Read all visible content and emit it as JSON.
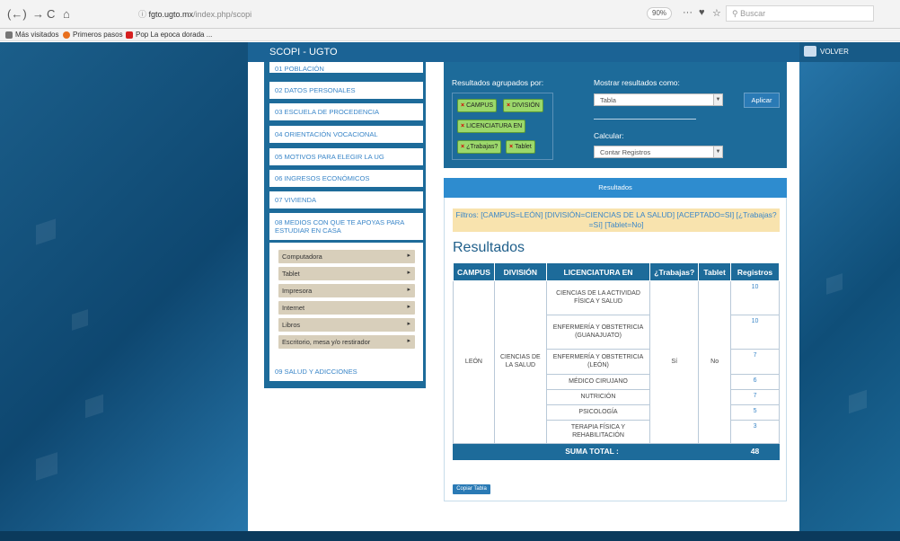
{
  "browser": {
    "url_info": "ⓘ",
    "url_host": "fgto.ugto.mx",
    "url_path": "/index.php/scopi",
    "zoom": "90%",
    "search_placeholder": "Buscar",
    "bookmarks": [
      {
        "label": "Más visitados",
        "color": "#777777"
      },
      {
        "label": "Primeros pasos",
        "color": "#e8701e"
      },
      {
        "label": "Pop La epoca dorada ...",
        "color": "#d62020"
      }
    ]
  },
  "header": {
    "title": "SCOPI - UGTO",
    "volver": "VOLVER"
  },
  "sidebar": {
    "items": [
      {
        "label": "01 POBLACIÓN"
      },
      {
        "label": "02 DATOS PERSONALES"
      },
      {
        "label": "03 ESCUELA DE PROCEDENCIA"
      },
      {
        "label": "04 ORIENTACIÓN VOCACIONAL"
      },
      {
        "label": "05 MOTIVOS PARA ELEGIR LA UG"
      },
      {
        "label": "06 INGRESOS ECONÓMICOS"
      },
      {
        "label": "07 VIVIENDA"
      },
      {
        "label": "08 MEDIOS CON QUE TE APOYAS PARA ESTUDIAR EN CASA"
      },
      {
        "label": "09 SALUD Y ADICCIONES"
      }
    ],
    "subitems": [
      "Computadora",
      "Tablet",
      "Impresora",
      "Internet",
      "Libros",
      "Escritorio, mesa y/o restirador"
    ]
  },
  "controls": {
    "group_label": "Resultados agrupados por:",
    "chips": [
      "CAMPUS",
      "DIVISIÓN",
      "LICENCIATURA EN",
      "¿Trabajas?",
      "Tablet"
    ],
    "show_label": "Mostrar resultados como:",
    "show_value": "Tabla",
    "apply": "Aplicar",
    "calc_label": "Calcular:",
    "calc_value": "Contar Registros"
  },
  "results": {
    "header": "Resultados",
    "filters": "Filtros: [CAMPUS=LEÓN] [DIVISIÓN=CIENCIAS DE LA SALUD] [ACEPTADO=SI] [¿Trabajas?=Sí] [Tablet=No]",
    "title": "Resultados",
    "columns": [
      "CAMPUS",
      "DIVISIÓN",
      "LICENCIATURA EN",
      "¿Trabajas?",
      "Tablet",
      "Registros"
    ],
    "campus": "LEÓN",
    "division": "CIENCIAS DE LA SALUD",
    "trabajas": "Sí",
    "tablet": "No",
    "rows": [
      {
        "licenciatura": "CIENCIAS DE LA ACTIVIDAD FÍSICA Y SALUD",
        "registros": "10"
      },
      {
        "licenciatura": "ENFERMERÍA Y OBSTETRICIA (GUANAJUATO)",
        "registros": "10"
      },
      {
        "licenciatura": "ENFERMERÍA Y OBSTETRICIA (LEÓN)",
        "registros": "7"
      },
      {
        "licenciatura": "MÉDICO CIRUJANO",
        "registros": "6"
      },
      {
        "licenciatura": "NUTRICIÓN",
        "registros": "7"
      },
      {
        "licenciatura": "PSICOLOGÍA",
        "registros": "5"
      },
      {
        "licenciatura": "TERAPIA FÍSICA Y REHABILITACIÓN",
        "registros": "3"
      }
    ],
    "total_label": "SUMA TOTAL :",
    "total_value": "48",
    "copy_button": "Copiar Tabla"
  }
}
